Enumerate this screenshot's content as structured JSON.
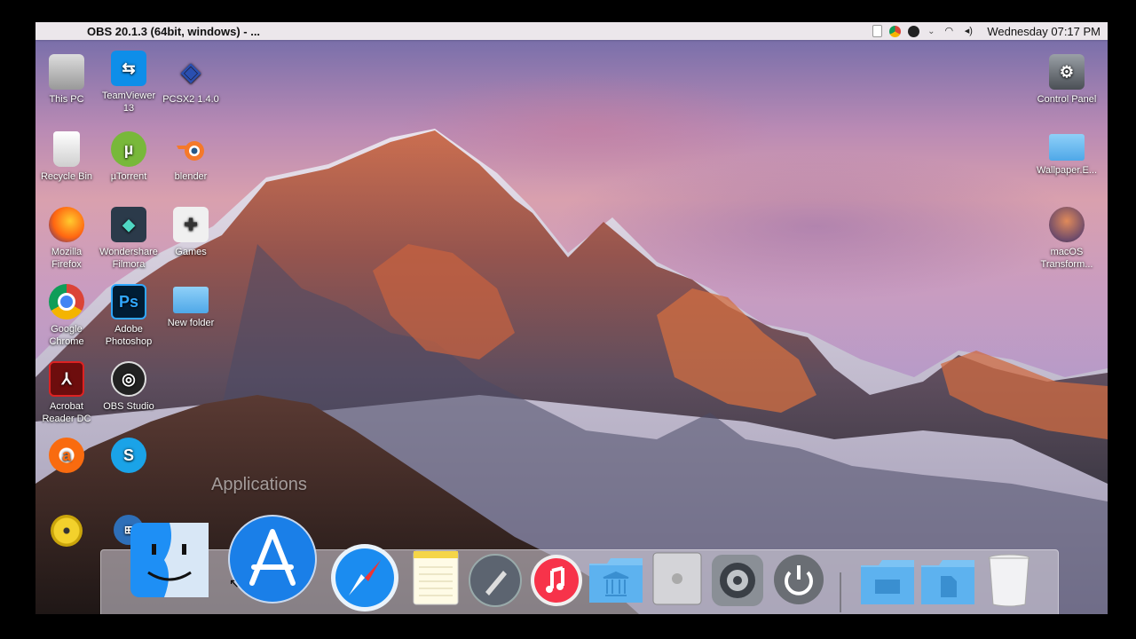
{
  "menubar": {
    "apple_glyph": "",
    "app_title": "OBS 20.1.3 (64bit, windows) - ...",
    "clock": "Wednesday 07:17 PM",
    "tray_icons": [
      "document-icon",
      "chrome-icon",
      "obs-icon",
      "chevron-up-icon",
      "wifi-icon",
      "volume-icon"
    ]
  },
  "desktop_left": [
    {
      "label": "This PC",
      "icon": "computer-icon"
    },
    {
      "label": "TeamViewer 13",
      "icon": "teamviewer-icon"
    },
    {
      "label": "PCSX2 1.4.0",
      "icon": "pcsx2-icon"
    },
    {
      "label": "Recycle Bin",
      "icon": "recycle-bin-icon"
    },
    {
      "label": "µTorrent",
      "icon": "utorrent-icon"
    },
    {
      "label": "blender",
      "icon": "blender-icon"
    },
    {
      "label": "Mozilla Firefox",
      "icon": "firefox-icon"
    },
    {
      "label": "Wondershare Filmora",
      "icon": "filmora-icon"
    },
    {
      "label": "Games",
      "icon": "games-icon"
    },
    {
      "label": "Google Chrome",
      "icon": "chrome-icon"
    },
    {
      "label": "Adobe Photoshop",
      "icon": "photoshop-icon"
    },
    {
      "label": "New folder",
      "icon": "folder-icon"
    },
    {
      "label": "Acrobat Reader DC",
      "icon": "acrobat-icon"
    },
    {
      "label": "OBS Studio",
      "icon": "obs-icon"
    },
    {
      "label": "",
      "icon": "avast-icon"
    },
    {
      "label": "",
      "icon": "skype-icon"
    },
    {
      "label": "",
      "icon": "dvd-icon"
    },
    {
      "label": "",
      "icon": "app-icon"
    }
  ],
  "desktop_right": [
    {
      "label": "Control Panel",
      "icon": "control-panel-icon"
    },
    {
      "label": "Wallpaper.E...",
      "icon": "folder-icon"
    },
    {
      "label": "macOS Transform...",
      "icon": "macos-transform-icon"
    }
  ],
  "dock_tooltip": "Applications",
  "dock": [
    "finder-icon",
    "app-store-icon",
    "safari-icon",
    "notes-icon",
    "launchpad-icon",
    "itunes-icon",
    "library-folder-icon",
    "mac-pro-icon",
    "system-preferences-icon",
    "power-icon",
    "folder-icon",
    "documents-folder-icon",
    "trash-icon"
  ]
}
